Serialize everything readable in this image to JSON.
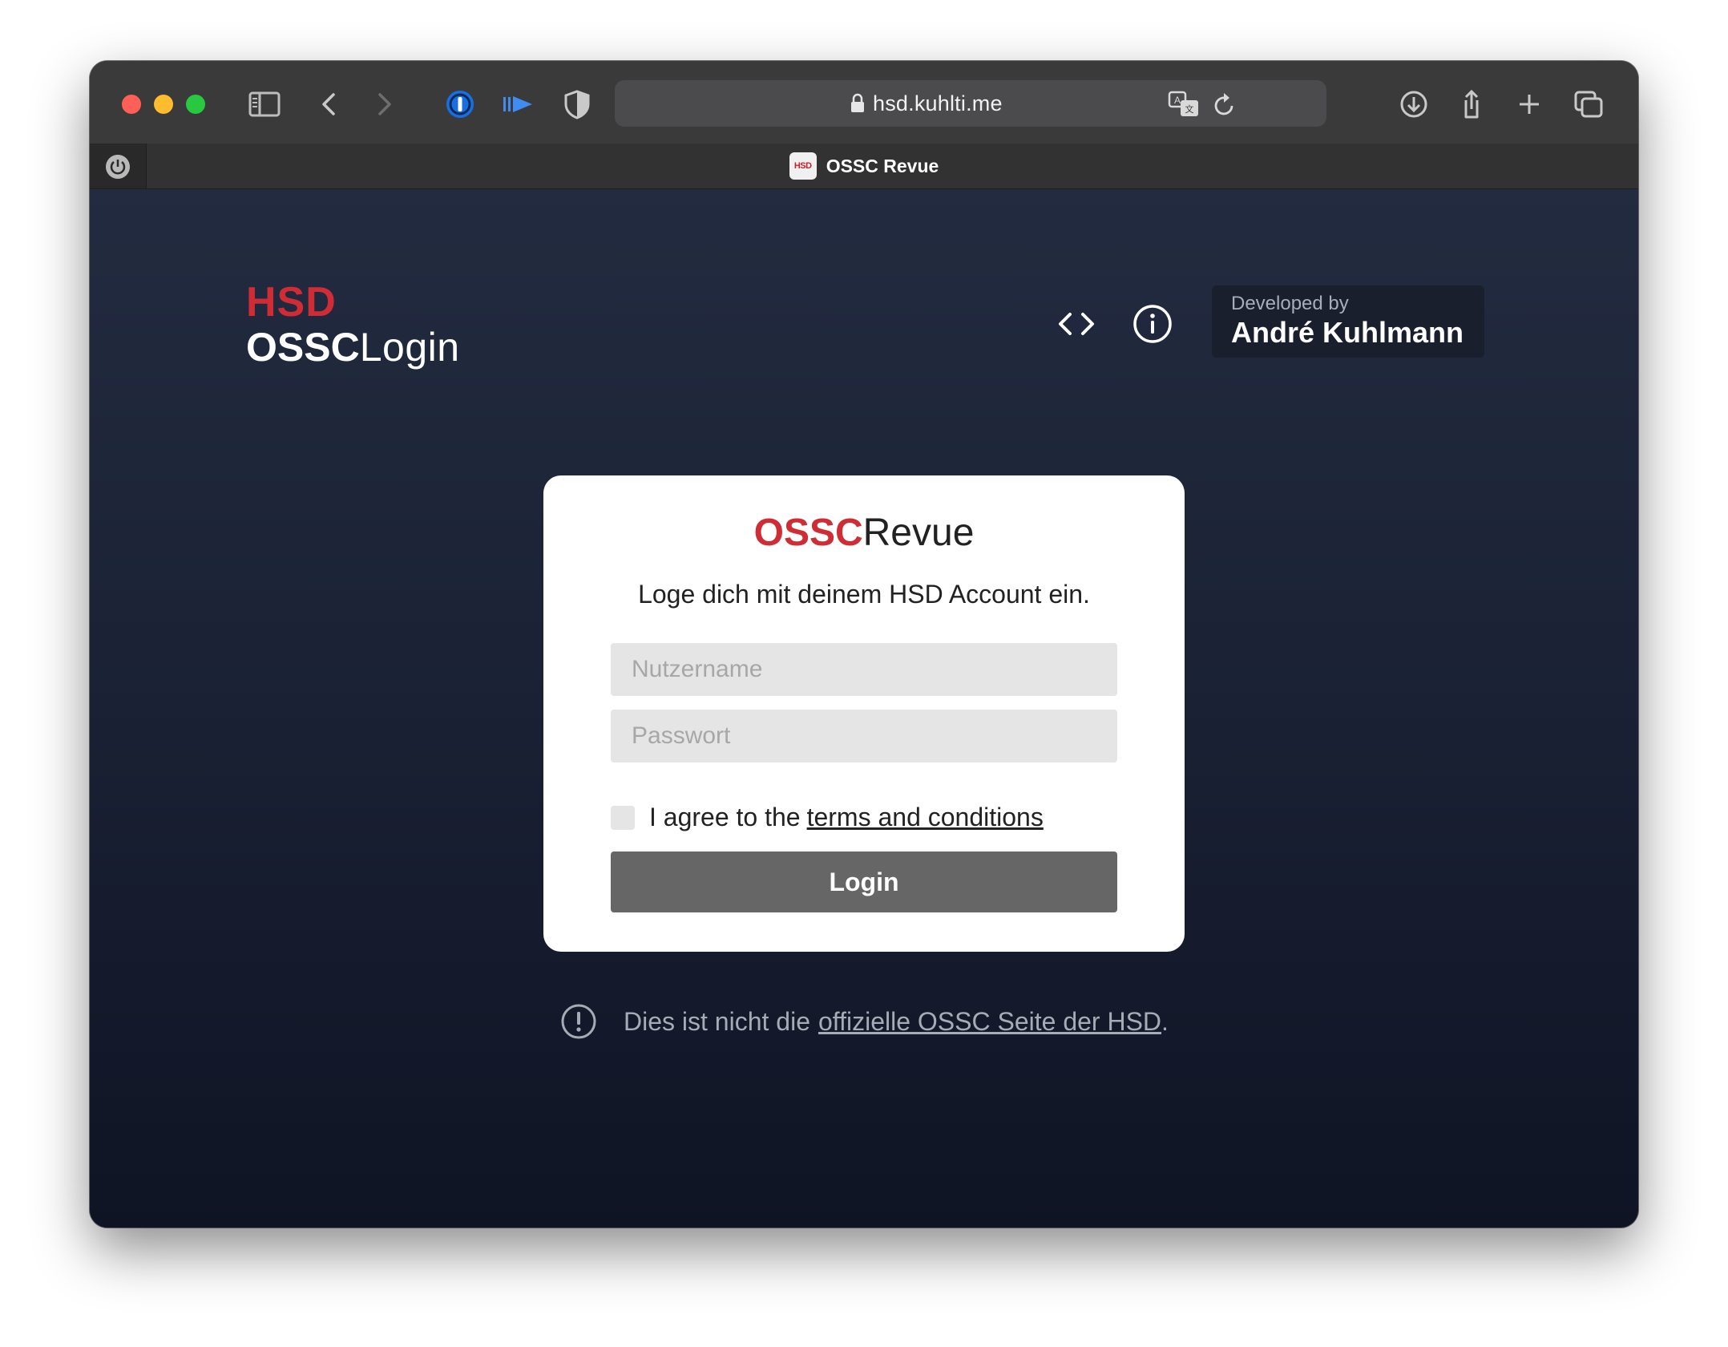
{
  "browser": {
    "url": "hsd.kuhlti.me",
    "tab_title": "OSSC Revue",
    "favicon_text": "HSD"
  },
  "brand": {
    "hsd": "HSD",
    "ossc": "OSSC",
    "login": "Login"
  },
  "header": {
    "developed_by_label": "Developed by",
    "developer_name": "André Kuhlmann"
  },
  "card": {
    "title_ossc": "OSSC",
    "title_revue": "Revue",
    "subtitle": "Loge dich mit deinem HSD Account ein.",
    "username_placeholder": "Nutzername",
    "password_placeholder": "Passwort",
    "agree_text": "I agree to the",
    "terms_link": "terms and conditions",
    "login_button": "Login"
  },
  "notice": {
    "text": "Dies ist nicht die",
    "link": "offizielle OSSC Seite der HSD",
    "end": "."
  },
  "colors": {
    "accent_red": "#d02c36",
    "page_bg_top": "#232b40",
    "page_bg_bottom": "#0f1424",
    "button_gray": "#666666"
  },
  "icons": [
    "sidebar-icon",
    "back-icon",
    "forward-icon",
    "password-manager-icon",
    "playback-icon",
    "shield-icon",
    "lock-icon",
    "translate-icon",
    "reload-icon",
    "download-icon",
    "share-icon",
    "new-tab-icon",
    "tabs-overview-icon",
    "power-icon",
    "code-icon",
    "info-icon",
    "alert-icon"
  ]
}
